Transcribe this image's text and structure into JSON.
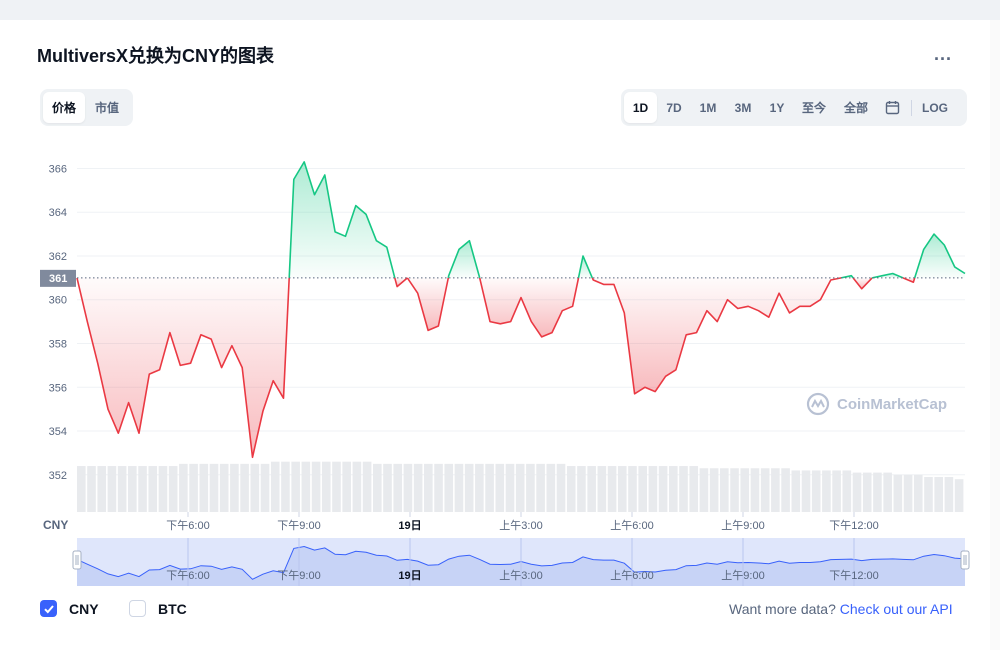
{
  "title": "MultiversX兑换为CNY的图表",
  "more_label": "...",
  "metric_tabs": [
    {
      "label": "价格",
      "active": true
    },
    {
      "label": "市值",
      "active": false
    }
  ],
  "range_tabs": [
    {
      "label": "1D",
      "active": true
    },
    {
      "label": "7D",
      "active": false
    },
    {
      "label": "1M",
      "active": false
    },
    {
      "label": "3M",
      "active": false
    },
    {
      "label": "1Y",
      "active": false
    },
    {
      "label": "至今",
      "active": false
    },
    {
      "label": "全部",
      "active": false
    }
  ],
  "calendar_icon": "calendar-icon",
  "log_label": "LOG",
  "watermark": "CoinMarketCap",
  "legend": [
    {
      "label": "CNY",
      "checked": true
    },
    {
      "label": "BTC",
      "checked": false
    }
  ],
  "api_text": "Want more data?",
  "api_link": "Check out our API",
  "colors": {
    "up": "#16c784",
    "down": "#ea3943",
    "accent": "#3861fb",
    "navigator": "#dfe6fb"
  },
  "chart_data": {
    "type": "line",
    "currency_label": "CNY",
    "baseline": 361,
    "baseline_label": "361",
    "ylim": [
      350.3,
      367.3
    ],
    "y_ticks": [
      352,
      354,
      356,
      358,
      360,
      362,
      364,
      366
    ],
    "x_range": [
      0,
      24
    ],
    "x_ticks": [
      {
        "label": "下午6:00",
        "x": 3.0
      },
      {
        "label": "下午9:00",
        "x": 6.0
      },
      {
        "label": "19日",
        "x": 9.0,
        "bold": true
      },
      {
        "label": "上午3:00",
        "x": 12.0
      },
      {
        "label": "上午6:00",
        "x": 15.0
      },
      {
        "label": "上午9:00",
        "x": 18.0
      },
      {
        "label": "下午12:00",
        "x": 21.0
      }
    ],
    "series": [
      {
        "values": [
          361.0,
          359.0,
          357.1,
          355.0,
          353.9,
          355.3,
          353.9,
          356.6,
          356.8,
          358.5,
          357.0,
          357.1,
          358.4,
          358.2,
          356.9,
          357.9,
          356.9,
          352.8,
          354.9,
          356.3,
          355.5,
          365.5,
          366.3,
          364.8,
          365.7,
          363.1,
          362.9,
          364.3,
          363.9,
          362.7,
          362.4,
          360.6,
          361.0,
          360.3,
          358.6,
          358.8,
          361.1,
          362.3,
          362.7,
          361.0,
          359.0,
          358.9,
          359.0,
          360.1,
          359.0,
          358.3,
          358.5,
          359.5,
          359.7,
          362.0,
          360.9,
          360.7,
          360.7,
          359.4,
          355.7,
          356.0,
          355.8,
          356.5,
          356.8,
          358.4,
          358.5,
          359.5,
          359.0,
          360.0,
          359.6,
          359.7,
          359.5,
          359.2,
          360.3,
          359.4,
          359.7,
          359.7,
          360.0,
          360.9,
          361.0,
          361.1,
          360.5,
          361.0,
          361.1,
          361.2,
          361.0,
          360.8,
          362.3,
          363.0,
          362.5,
          361.5,
          361.2
        ],
        "volume": [
          352.4,
          352.4,
          352.4,
          352.4,
          352.4,
          352.4,
          352.4,
          352.4,
          352.4,
          352.4,
          352.5,
          352.5,
          352.5,
          352.5,
          352.5,
          352.5,
          352.5,
          352.5,
          352.5,
          352.6,
          352.6,
          352.6,
          352.6,
          352.6,
          352.6,
          352.6,
          352.6,
          352.6,
          352.6,
          352.5,
          352.5,
          352.5,
          352.5,
          352.5,
          352.5,
          352.5,
          352.5,
          352.5,
          352.5,
          352.5,
          352.5,
          352.5,
          352.5,
          352.5,
          352.5,
          352.5,
          352.5,
          352.5,
          352.4,
          352.4,
          352.4,
          352.4,
          352.4,
          352.4,
          352.4,
          352.4,
          352.4,
          352.4,
          352.4,
          352.4,
          352.4,
          352.3,
          352.3,
          352.3,
          352.3,
          352.3,
          352.3,
          352.3,
          352.3,
          352.3,
          352.2,
          352.2,
          352.2,
          352.2,
          352.2,
          352.2,
          352.1,
          352.1,
          352.1,
          352.1,
          352.0,
          352.0,
          352.0,
          351.9,
          351.9,
          351.9,
          351.8
        ]
      }
    ]
  }
}
